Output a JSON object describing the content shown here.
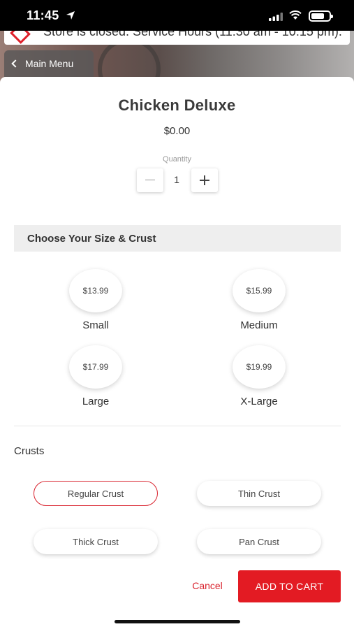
{
  "status_bar": {
    "time": "11:45"
  },
  "notice": {
    "text": "Store is closed. Service Hours (11:30 am - 10:15 pm)."
  },
  "nav": {
    "back_label": "Main Menu"
  },
  "item": {
    "title": "Chicken Deluxe",
    "price": "$0.00"
  },
  "quantity": {
    "label": "Quantity",
    "value": "1"
  },
  "size_section": {
    "heading": "Choose Your Size & Crust",
    "options": [
      {
        "price": "$13.99",
        "name": "Small"
      },
      {
        "price": "$15.99",
        "name": "Medium"
      },
      {
        "price": "$17.99",
        "name": "Large"
      },
      {
        "price": "$19.99",
        "name": "X-Large"
      }
    ]
  },
  "crusts": {
    "label": "Crusts",
    "options": [
      {
        "label": "Regular Crust",
        "selected": true
      },
      {
        "label": "Thin Crust",
        "selected": false
      },
      {
        "label": "Thick Crust",
        "selected": false
      },
      {
        "label": "Pan Crust",
        "selected": false
      }
    ]
  },
  "actions": {
    "cancel_label": "Cancel",
    "add_to_cart_label": "ADD TO CART"
  },
  "colors": {
    "accent": "#e31b23"
  }
}
